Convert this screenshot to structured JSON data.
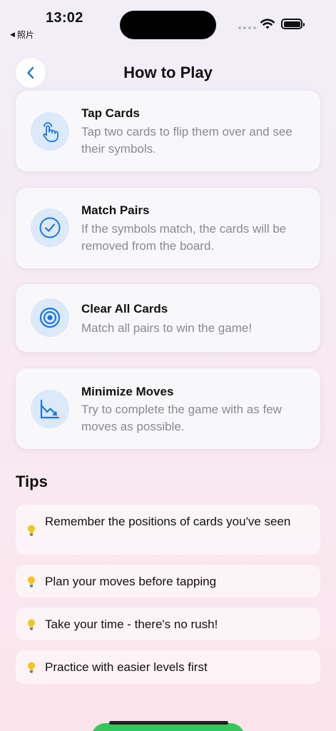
{
  "status": {
    "time": "13:02",
    "back_app": "照片"
  },
  "nav": {
    "back_icon": "chevron-left-icon",
    "title": "How to Play"
  },
  "colors": {
    "accent": "#1877e8",
    "icon_bg": "#dce9f8",
    "bulb": "#f5c518",
    "desc": "#8a8a8e"
  },
  "steps": [
    {
      "icon": "tap-hand-icon",
      "title": "Tap Cards",
      "description": "Tap two cards to flip them over and see their symbols."
    },
    {
      "icon": "checkmark-circle-icon",
      "title": "Match Pairs",
      "description": "If the symbols match, the cards will be removed from the board."
    },
    {
      "icon": "target-icon",
      "title": "Clear All Cards",
      "description": "Match all pairs to win the game!"
    },
    {
      "icon": "chart-down-icon",
      "title": "Minimize Moves",
      "description": "Try to complete the game with as few moves as possible."
    }
  ],
  "tips": {
    "title": "Tips",
    "items": [
      "Remember the positions of cards you've seen",
      "Plan your moves before tapping",
      "Take your time - there's no rush!",
      "Practice with easier levels first"
    ]
  }
}
